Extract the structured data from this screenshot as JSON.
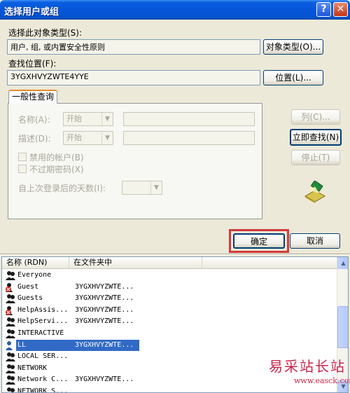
{
  "window": {
    "title": "选择用户或组",
    "help_glyph": "?",
    "close_glyph": "✕"
  },
  "object_type": {
    "label": "选择此对象类型(S):",
    "value": "用户, 组, 或内置安全性原则",
    "button": "对象类型(O)..."
  },
  "location": {
    "label": "查找位置(F):",
    "value": "3YGXHVYZWTE4YYE",
    "button": "位置(L)..."
  },
  "tab": {
    "label": "一般性查询"
  },
  "query": {
    "name_label": "名称(A):",
    "name_mode": "开始",
    "desc_label": "描述(D):",
    "desc_mode": "开始",
    "disabled_accounts": "禁用的帐户(B)",
    "no_expire_password": "不过期密码(X)",
    "days_since_login_label": "自上次登录后的天数(I):"
  },
  "side_buttons": {
    "columns": "列(C)...",
    "find_now": "立即查找(N)",
    "stop": "停止(T)"
  },
  "actions": {
    "ok": "确定",
    "cancel": "取消"
  },
  "results": {
    "columns": [
      "名称 (RDN)",
      "在文件夹中"
    ],
    "rows": [
      {
        "name": "Everyone",
        "folder": "",
        "icon": "group-icon",
        "selected": false
      },
      {
        "name": "Guest",
        "folder": "3YGXHVYZWTE...",
        "icon": "disabled-user-icon",
        "selected": false
      },
      {
        "name": "Guests",
        "folder": "3YGXHVYZWTE...",
        "icon": "group-icon",
        "selected": false
      },
      {
        "name": "HelpAssis...",
        "folder": "3YGXHVYZWTE...",
        "icon": "disabled-user-icon",
        "selected": false
      },
      {
        "name": "HelpServi...",
        "folder": "3YGXHVYZWTE...",
        "icon": "group-icon",
        "selected": false
      },
      {
        "name": "INTERACTIVE",
        "folder": "",
        "icon": "group-icon",
        "selected": false
      },
      {
        "name": "LL",
        "folder": "3YGXHVYZWTE...",
        "icon": "user-icon",
        "selected": true
      },
      {
        "name": "LOCAL SER...",
        "folder": "",
        "icon": "group-icon",
        "selected": false
      },
      {
        "name": "NETWORK",
        "folder": "",
        "icon": "group-icon",
        "selected": false
      },
      {
        "name": "Network C...",
        "folder": "3YGXHVYZWTE...",
        "icon": "group-icon",
        "selected": false
      },
      {
        "name": "NETWORK S...",
        "folder": "",
        "icon": "group-icon",
        "selected": false
      }
    ]
  },
  "watermark": {
    "title": "易采站长站",
    "url": "www.easck.com"
  },
  "colors": {
    "titlebar": "#0655d8",
    "dialog_bg": "#ece9d8",
    "selection": "#316ac5",
    "highlight": "#d23a3a",
    "watermark": "#c8264a"
  }
}
